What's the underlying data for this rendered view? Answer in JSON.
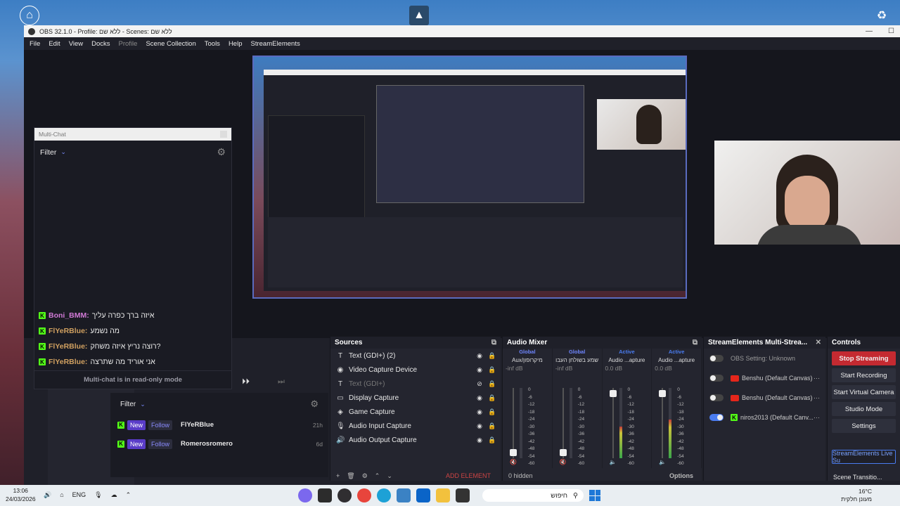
{
  "window": {
    "title": "OBS 32.1.0 - Profile: ללא שם - Scenes: ללא שם"
  },
  "menu": [
    "File",
    "Edit",
    "View",
    "Docks",
    "Profile",
    "Scene Collection",
    "Tools",
    "Help",
    "StreamElements"
  ],
  "chat": {
    "title": "Multi-Chat",
    "filter": "Filter",
    "messages": [
      {
        "user": "Boni_BMM:",
        "text": "איזה ברך כפרה עליך",
        "color": "#d17ad6"
      },
      {
        "user": "FlYeRBlue:",
        "text": "מה נשמע",
        "color": "#d0a060"
      },
      {
        "user": "FlYeRBlue:",
        "text": "רוצה נריץ איזה משחק?",
        "color": "#d0a060"
      },
      {
        "user": "FlYeRBlue:",
        "text": "אני אוריד מה שתרצה",
        "color": "#d0a060"
      }
    ],
    "footer": "Multi-chat is in read-only mode"
  },
  "events": {
    "filter": "Filter",
    "rows": [
      {
        "new": "New",
        "follow": "Follow",
        "name": "FlYeRBlue",
        "time": "21h"
      },
      {
        "new": "New",
        "follow": "Follow",
        "name": "Romerosromero",
        "time": "6d"
      }
    ]
  },
  "sources": {
    "title": "Sources",
    "items": [
      {
        "name": "Text (GDI+) (2)",
        "icon": "T",
        "disabled": false
      },
      {
        "name": "Video Capture Device",
        "icon": "◉",
        "disabled": false
      },
      {
        "name": "Text (GDI+)",
        "icon": "T",
        "disabled": true
      },
      {
        "name": "Display Capture",
        "icon": "▭",
        "disabled": false
      },
      {
        "name": "Game Capture",
        "icon": "◈",
        "disabled": false
      },
      {
        "name": "Audio Input Capture",
        "icon": "🎙",
        "disabled": false
      },
      {
        "name": "Audio Output Capture",
        "icon": "🔊",
        "disabled": false
      }
    ],
    "add_element": "ADD ELEMENT"
  },
  "mixer": {
    "title": "Audio Mixer",
    "columns": [
      {
        "status": "Global",
        "status_color": "#6f86ff",
        "name": "Aux/מיקרופון",
        "db": "-inf dB"
      },
      {
        "status": "Global",
        "status_color": "#6f86ff",
        "name": "שמע בשולחן העבו",
        "db": "-inf dB"
      },
      {
        "status": "Active",
        "status_color": "#4a7cf0",
        "name": "Audio ...apture",
        "db": "0.0 dB"
      },
      {
        "status": "Active",
        "status_color": "#4a7cf0",
        "name": "Audio ...apture",
        "db": "0.0 dB"
      }
    ],
    "scale": [
      "0",
      "-6",
      "-12",
      "-18",
      "-24",
      "-30",
      "-36",
      "-42",
      "-48",
      "-54",
      "-60"
    ],
    "hidden": "0 hidden",
    "options": "Options"
  },
  "streamelements": {
    "title": "StreamElements Multi-Strea...",
    "rows": [
      {
        "label": "OBS Setting: Unknown",
        "on": false
      },
      {
        "label": "Benshu (Default Canvas)",
        "on": false
      },
      {
        "label": "Benshu (Default Canvas)",
        "on": false
      },
      {
        "label": "niros2013 (Default Canv...",
        "on": true
      }
    ]
  },
  "controls": {
    "title": "Controls",
    "buttons": [
      "Stop Streaming",
      "Start Recording",
      "Start Virtual Camera",
      "Studio Mode",
      "Settings"
    ],
    "live": "StreamElements Live Su",
    "transition": "Scene Transitio..."
  },
  "taskbar": {
    "time": "13:06",
    "date": "24/03/2026",
    "lang": "ENG",
    "search": "חיפוש",
    "temp": "16°C",
    "weather": "מעונן חלקית"
  }
}
